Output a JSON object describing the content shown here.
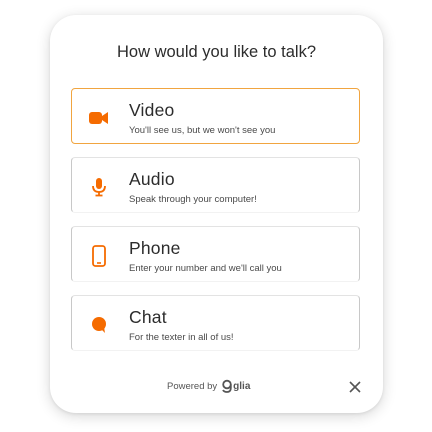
{
  "header": {
    "title": "How would you like to talk?"
  },
  "options": [
    {
      "icon": "video-camera-icon",
      "label": "Video",
      "description": "You'll see us, but we won't see you"
    },
    {
      "icon": "microphone-icon",
      "label": "Audio",
      "description": "Speak through your computer!"
    },
    {
      "icon": "phone-icon",
      "label": "Phone",
      "description": "Enter your number and we'll call you"
    },
    {
      "icon": "chat-bubble-icon",
      "label": "Chat",
      "description": "For the texter in all of us!"
    }
  ],
  "footer": {
    "powered_by": "Powered by",
    "brand": "glia",
    "close_icon": "close-icon"
  },
  "colors": {
    "accent": "#f56b00",
    "selected_border": "#f1a540",
    "text": "#2c2c2c"
  }
}
